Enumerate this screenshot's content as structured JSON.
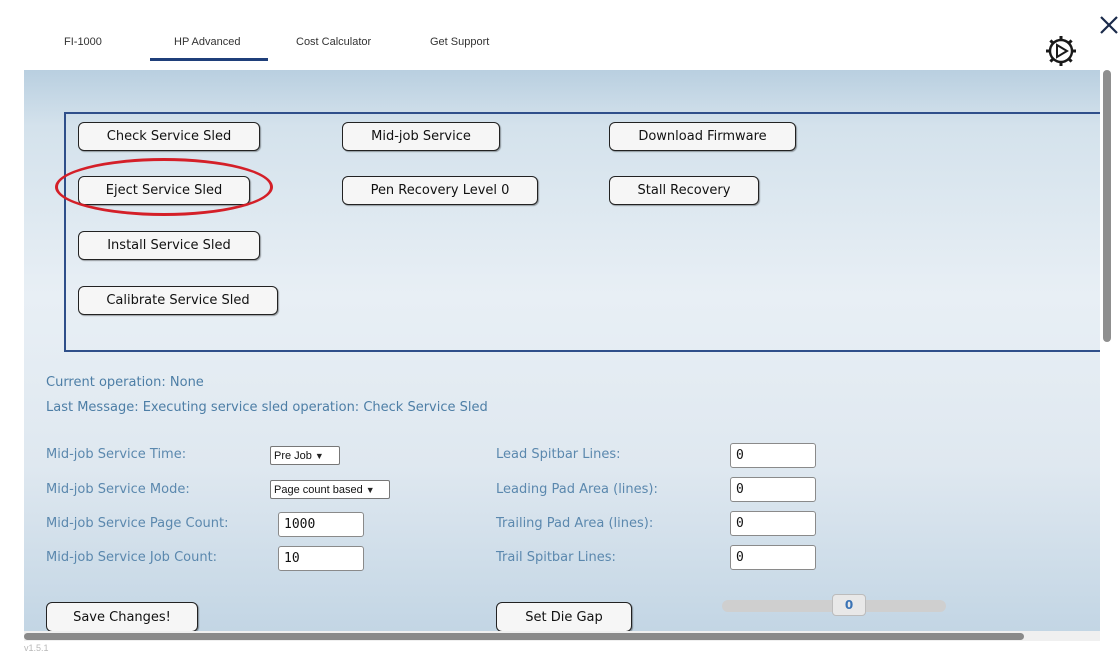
{
  "tabs": [
    {
      "label": "FI-1000"
    },
    {
      "label": "HP Advanced",
      "selected": true
    },
    {
      "label": "Cost Calculator"
    },
    {
      "label": "Get Support"
    }
  ],
  "icons": {
    "settings": "gear-icon",
    "close": "close-icon"
  },
  "service_sled": {
    "check": "Check Service Sled",
    "eject": "Eject Service Sled",
    "install": "Install Service Sled",
    "calibrate": "Calibrate Service Sled",
    "mid_job": "Mid-job Service",
    "pen_recovery": "Pen Recovery Level 0",
    "download_firmware": "Download Firmware",
    "stall_recovery": "Stall Recovery"
  },
  "status": {
    "current_operation": "Current operation: None",
    "last_message": "Last Message: Executing service sled operation: Check Service Sled"
  },
  "settings": {
    "service_time": {
      "label": "Mid-job Service Time:",
      "value": "Pre Job"
    },
    "service_mode": {
      "label": "Mid-job Service Mode:",
      "value": "Page count based"
    },
    "page_count": {
      "label": "Mid-job Service Page Count:",
      "value": "1000"
    },
    "job_count": {
      "label": "Mid-job Service Job Count:",
      "value": "10"
    },
    "lead_spitbar": {
      "label": "Lead Spitbar Lines:",
      "value": "0"
    },
    "leading_pad": {
      "label": "Leading Pad Area (lines):",
      "value": "0"
    },
    "trailing_pad": {
      "label": "Trailing Pad Area (lines):",
      "value": "0"
    },
    "trail_spitbar": {
      "label": "Trail Spitbar Lines:",
      "value": "0"
    }
  },
  "actions": {
    "save": "Save Changes!",
    "set_die_gap": "Set Die Gap",
    "die_gap_value": "0"
  },
  "version": "v1.5.1",
  "colors": {
    "annotation": "#d41f28",
    "box_border": "#2f4f8a",
    "label_text": "#5b88ae",
    "tab_underline": "#1f3f7a"
  }
}
